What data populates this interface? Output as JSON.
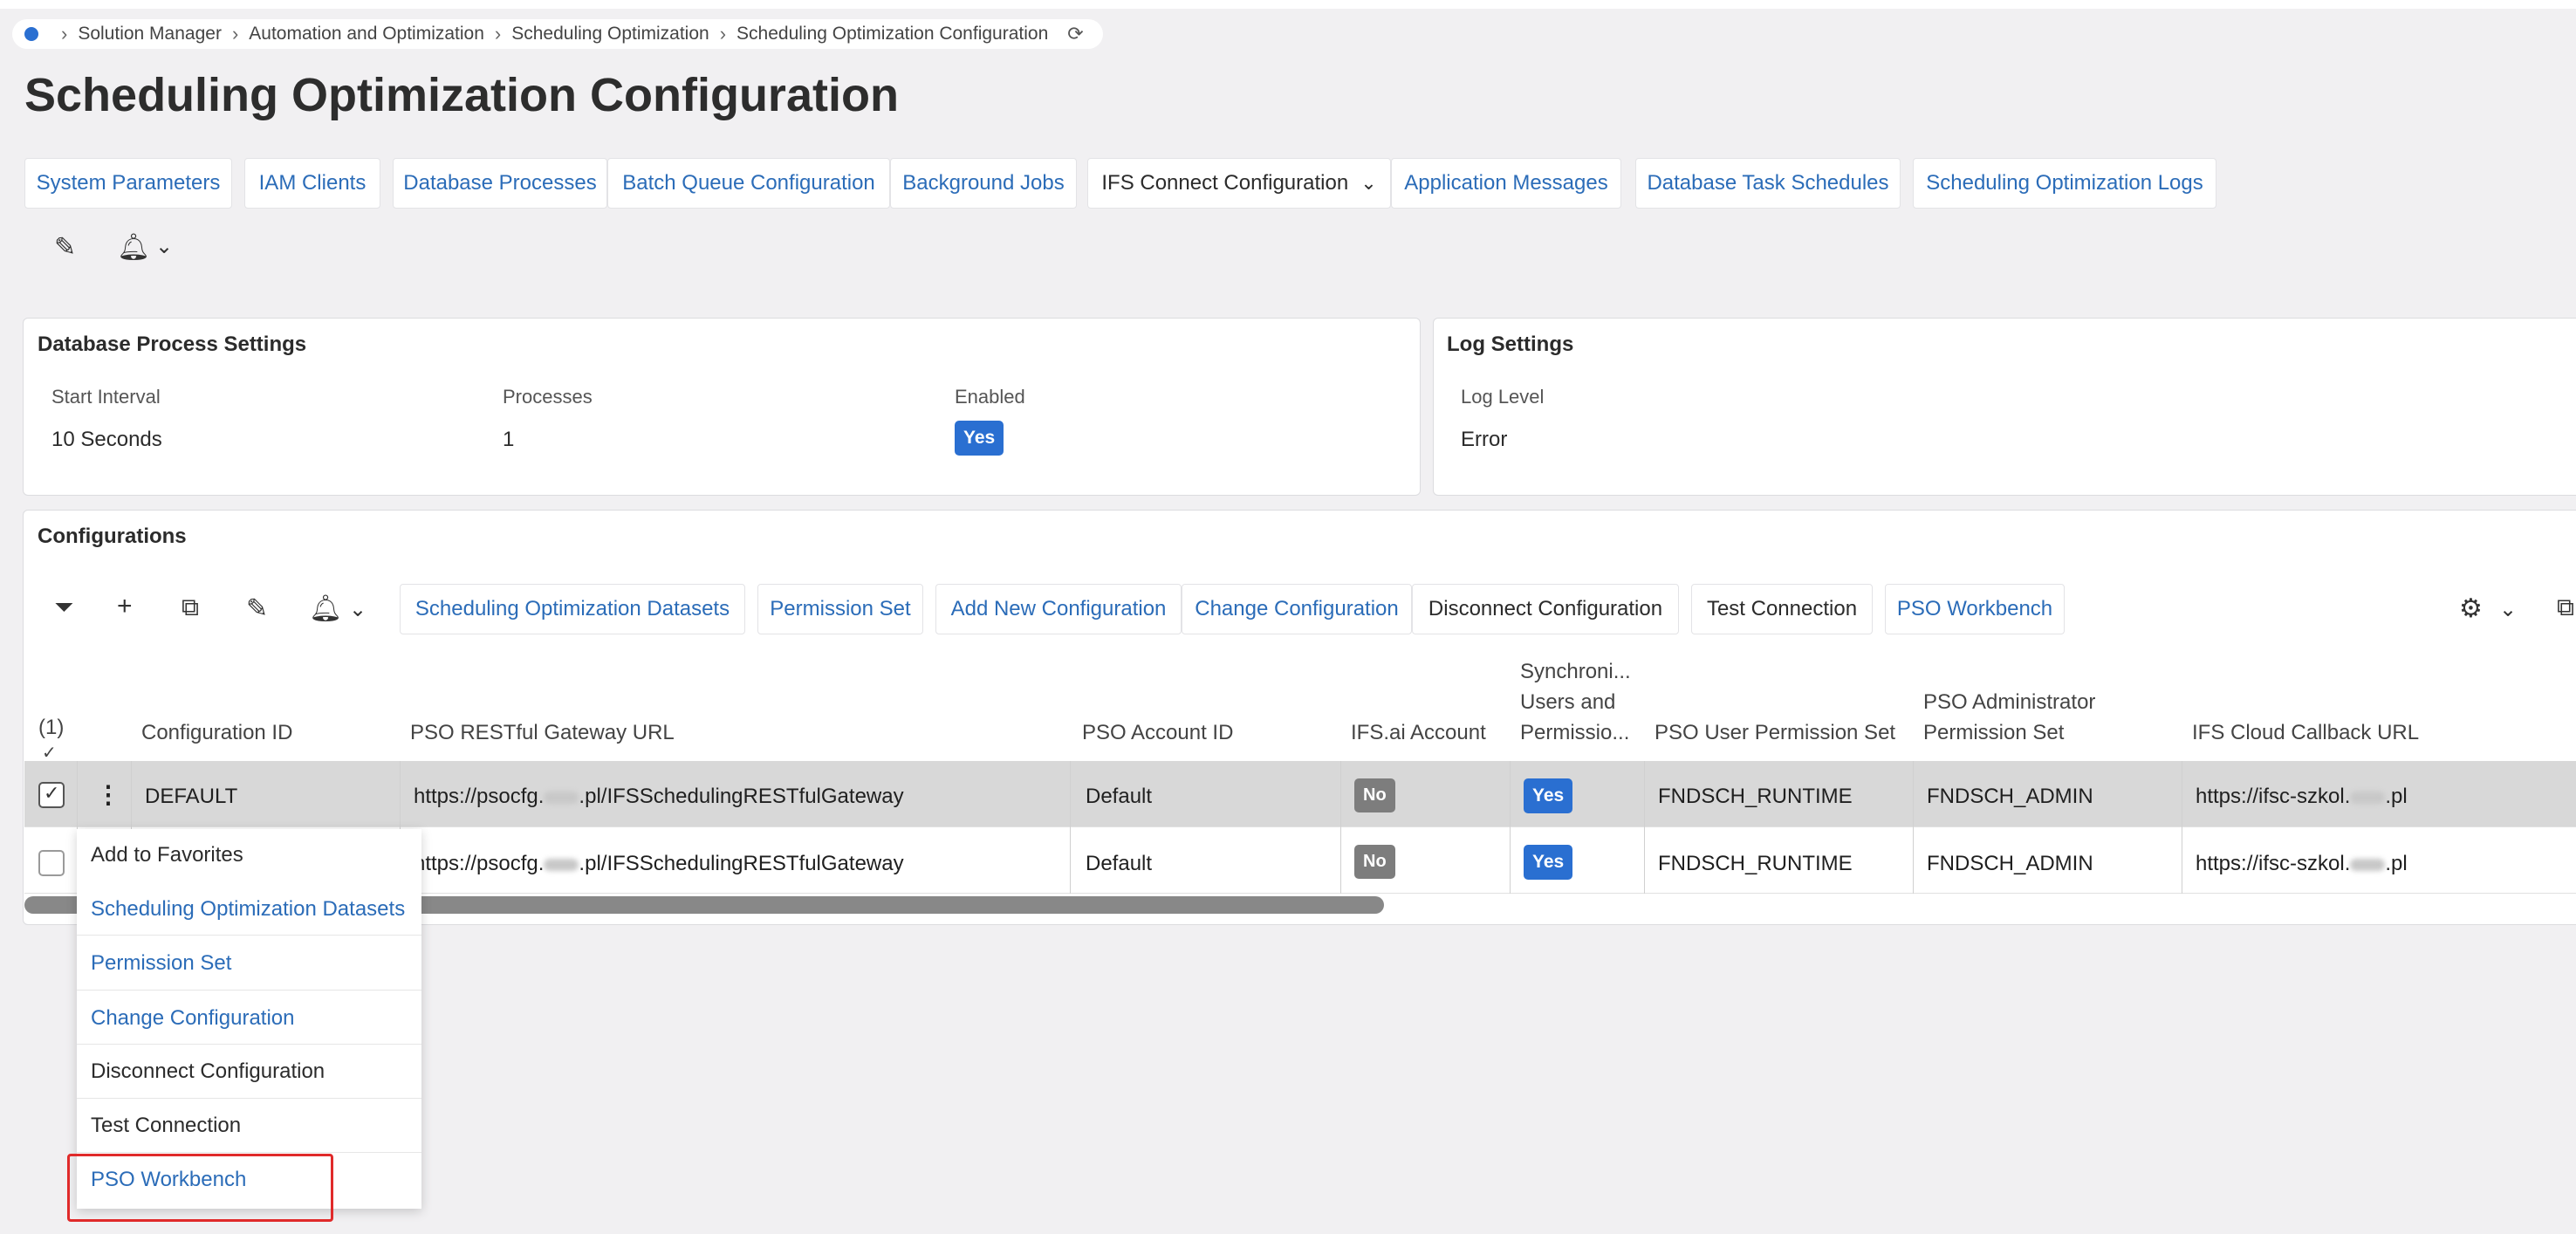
{
  "breadcrumb": [
    "Solution Manager",
    "Automation and Optimization",
    "Scheduling Optimization",
    "Scheduling Optimization Configuration"
  ],
  "page_title": "Scheduling Optimization Configuration",
  "tabs": [
    {
      "label": "System Parameters"
    },
    {
      "label": "IAM Clients"
    },
    {
      "label": "Database Processes"
    },
    {
      "label": "Batch Queue Configuration"
    },
    {
      "label": "Background Jobs"
    },
    {
      "label": "IFS Connect Configuration"
    },
    {
      "label": "Application Messages"
    },
    {
      "label": "Database Task Schedules"
    },
    {
      "label": "Scheduling Optimization Logs"
    }
  ],
  "db_process_settings": {
    "title": "Database Process Settings",
    "start_interval_label": "Start Interval",
    "start_interval_value": "10 Seconds",
    "processes_label": "Processes",
    "processes_value": "1",
    "enabled_label": "Enabled",
    "enabled_value": "Yes"
  },
  "log_settings": {
    "title": "Log Settings",
    "log_level_label": "Log Level",
    "log_level_value": "Error"
  },
  "configurations": {
    "title": "Configurations",
    "toolbar_buttons": [
      "Scheduling Optimization Datasets",
      "Permission Set",
      "Add New Configuration",
      "Change Configuration",
      "Disconnect Configuration",
      "Test Connection",
      "PSO Workbench"
    ],
    "selected_count": "(1)",
    "columns": [
      "Configuration ID",
      "PSO RESTful Gateway URL",
      "PSO Account ID",
      "IFS.ai Account",
      "Synchroni... Users and Permissio...",
      "PSO User Permission Set",
      "PSO Administrator Permission Set",
      "IFS Cloud Callback URL"
    ],
    "rows": [
      {
        "config_id": "DEFAULT",
        "gateway_pre": "https://psocfg.",
        "gateway_post": ".pl/IFSSchedulingRESTfulGateway",
        "account_id": "Default",
        "ifs_ai": "No",
        "sync": "Yes",
        "user_perm": "FNDSCH_RUNTIME",
        "admin_perm": "FNDSCH_ADMIN",
        "callback_pre": "https://ifsc-szkol.",
        "callback_post": ".pl"
      },
      {
        "config_id": "",
        "gateway_pre": "https://psocfg.",
        "gateway_post": ".pl/IFSSchedulingRESTfulGateway",
        "account_id": "Default",
        "ifs_ai": "No",
        "sync": "Yes",
        "user_perm": "FNDSCH_RUNTIME",
        "admin_perm": "FNDSCH_ADMIN",
        "callback_pre": "https://ifsc-szkol.",
        "callback_post": ".pl"
      }
    ]
  },
  "context_menu": [
    "Add to Favorites",
    "Scheduling Optimization Datasets",
    "Permission Set",
    "Change Configuration",
    "Disconnect Configuration",
    "Test Connection",
    "PSO Workbench"
  ],
  "colors": {
    "accent": "#2a6fd1",
    "link": "#2b6cb8",
    "highlight": "#e02a2a"
  }
}
